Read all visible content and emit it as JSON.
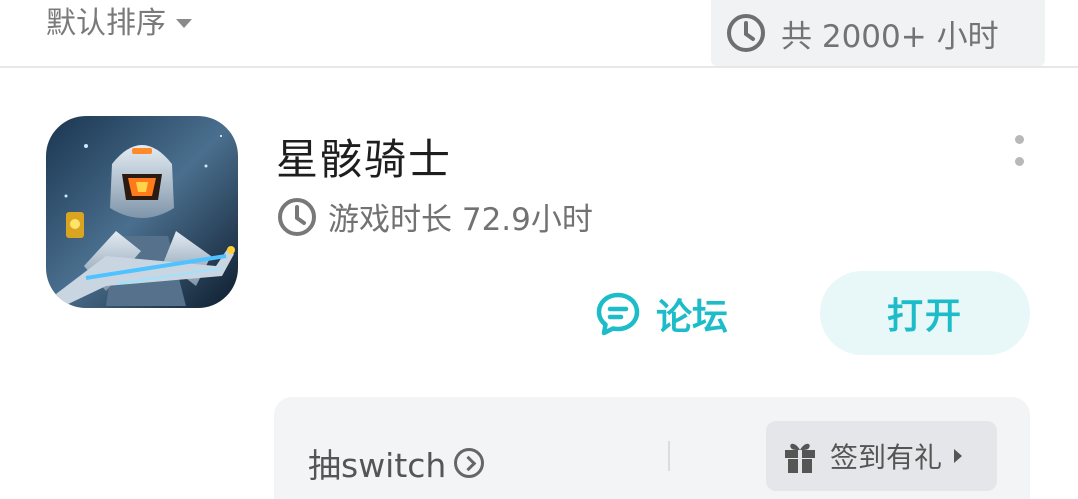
{
  "toolbar": {
    "sort_label": "默认排序",
    "total_hours": "共 2000+ 小时"
  },
  "game": {
    "title": "星骸骑士",
    "playtime": "游戏时长 72.9小时",
    "forum_label": "论坛",
    "open_label": "打开"
  },
  "promo": {
    "title": "抽switch",
    "sign_label": "签到有礼"
  },
  "colors": {
    "accent": "#1cbcc8",
    "accent_bg": "#e8f8f9"
  },
  "icons": [
    "clock-icon",
    "chevron-down-icon",
    "more-vertical-icon",
    "chat-bubble-icon",
    "chevron-right-circle-icon",
    "gift-icon",
    "caret-right-icon"
  ]
}
